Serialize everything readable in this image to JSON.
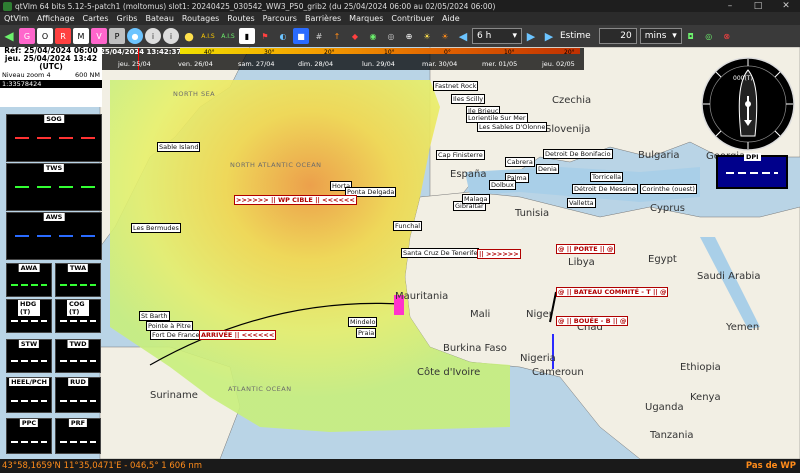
{
  "window": {
    "title": "qtVlm 64 bits 5.12-5-patch1 (moltomus) slot1: 20240425_030542_WW3_P50_grib2 (du 25/04/2024 06:00 au 02/05/2024 06:00)",
    "minimize": "–",
    "maximize": "□",
    "close": "✕"
  },
  "menu": [
    "QtVlm",
    "Affichage",
    "Cartes",
    "Gribs",
    "Bateau",
    "Routages",
    "Routes",
    "Parcours",
    "Barrières",
    "Marques",
    "Contribuer",
    "Aide"
  ],
  "toolbar": {
    "ais_label": "A.I.S",
    "als_label": "A.I.S",
    "step_value": "6 h",
    "estime_label": "Estime",
    "estime_value": "20",
    "estime_unit": "mins"
  },
  "info": {
    "ref": "Réf: 25/04/2024 06:00",
    "current": "jeu. 25/04/2024 13:42",
    "tz": "(UTC)",
    "zoom": "Niveau zoom 4",
    "scale_nm": "600 NM",
    "scale_ratio": "1:33578424"
  },
  "timeline": {
    "current": "25/04/2024 13:42:37",
    "ticks": [
      "40°",
      "30°",
      "20°",
      "10°",
      "0°",
      "10°",
      "20°"
    ],
    "days": [
      "jeu. 25/04",
      "ven. 26/04",
      "sam. 27/04",
      "dim. 28/04",
      "lun. 29/04",
      "mar. 30/04",
      "mer. 01/05",
      "jeu. 02/05"
    ]
  },
  "instruments": [
    {
      "label": "SOG",
      "color": "#ff3333"
    },
    {
      "label": "TWS",
      "color": "#33ff33"
    },
    {
      "label": "AWS",
      "color": "#2a6bff"
    },
    {
      "label": "AWA",
      "color": "#33ff33"
    },
    {
      "label": "TWA",
      "color": "#33ff33"
    },
    {
      "label": "HDG (T)",
      "color": "#ffffff"
    },
    {
      "label": "COG (T)",
      "color": "#ffffff"
    },
    {
      "label": "STW",
      "color": "#ffffff"
    },
    {
      "label": "TWD",
      "color": "#ffffff"
    },
    {
      "label": "HEEL/PCH",
      "color": "#ffffff"
    },
    {
      "label": "RUD",
      "color": "#ffffff"
    },
    {
      "label": "PPC",
      "color": "#ffffff"
    },
    {
      "label": "PRF",
      "color": "#ffffff"
    }
  ],
  "dpi": {
    "label": "DPI",
    "color": "#ffffff"
  },
  "compass": {
    "heading": "000(T)"
  },
  "map": {
    "oceans": [
      "NORTH SEA",
      "NORTH ATLANTIC OCEAN",
      "ATLANTIC OCEAN"
    ],
    "countries": [
      "Czechia",
      "Slovenija",
      "Bulgaria",
      "España",
      "Tunisia",
      "Libya",
      "Egypt",
      "Mauritania",
      "Mali",
      "Niger",
      "Chad",
      "Nigeria",
      "Burkina Faso",
      "Côte d'Ivoire",
      "Cameroun",
      "Suriname",
      "Uganda",
      "Tanzania",
      "Yemen",
      "Saudi Arabia",
      "Cyprus",
      "Georgia",
      "Ethiopia",
      "Kenya"
    ],
    "places": [
      "Sable Island",
      "Les Bermudes",
      "Horta",
      "Ponta Delgada",
      "Funchal",
      "Santa Cruz De Tenerife",
      "Fastnet Rock",
      "Iles Scilly",
      "Ile Brieuc",
      "Lorientile Sur Mer",
      "Les Sables D'Olonne",
      "Cap Finisterre",
      "Gibraltar",
      "Malaga",
      "Palma",
      "Denia",
      "Cabrera",
      "Dolbux",
      "Valletta",
      "Détroit De Messine",
      "Mindelo",
      "Praia",
      "St Barth",
      "Pointe à Pitre",
      "Fort De France",
      "Torricella",
      "Corinthe (ouest)",
      "Detroit De Bonifacio"
    ],
    "waypoints": [
      ">>>>>> || WP CIBLE || <<<<<<",
      "ARRIVÉE || <<<<<<",
      "|| >>>>>>",
      "@ || PORTE || @",
      "@ || BATEAU COMMITÉ - T || @",
      "@ || BOUÉE - B || @"
    ]
  },
  "status": {
    "position": "43°58,1659'N 11°35,0471'E - 046,5° 1 606 nm",
    "waypoint": "Pas de WP"
  },
  "colors": {
    "accent": "#ff8c1a",
    "route": "#000000",
    "mark": "#b00000"
  }
}
